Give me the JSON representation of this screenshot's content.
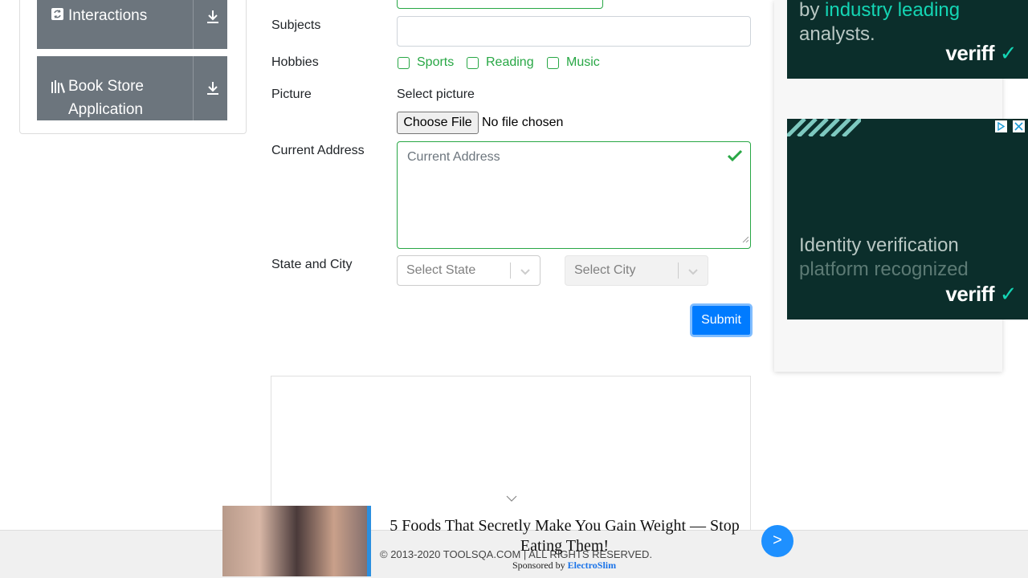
{
  "sidebar": {
    "groups": [
      {
        "label": "Interactions",
        "icon": "refresh-icon"
      },
      {
        "label_line1": "Book Store",
        "label_line2": "Application",
        "icon": "books-icon"
      }
    ]
  },
  "form": {
    "subjects_label": "Subjects",
    "hobbies_label": "Hobbies",
    "hobbies": [
      "Sports",
      "Reading",
      "Music"
    ],
    "picture_label": "Picture",
    "picture_prompt": "Select picture",
    "file_button": "Choose File",
    "file_status": "No file chosen",
    "address_label": "Current Address",
    "address_placeholder": "Current Address",
    "state_city_label": "State and City",
    "state_placeholder": "Select State",
    "city_placeholder": "Select City",
    "submit_label": "Submit"
  },
  "ads": {
    "top_line1_prefix": "by ",
    "top_line1_highlight": "industry leading",
    "top_line2": "analysts.",
    "brand": "veriff",
    "mid_line1": "Identity verification",
    "mid_line2": "platform recognized"
  },
  "footer": {
    "copyright": "© 2013-2020 TOOLSQA.COM | ALL RIGHTS RESERVED."
  },
  "sponsored": {
    "title": "5 Foods That Secretly Make You Gain Weight — Stop Eating Them!",
    "by_prefix": "Sponsored by ",
    "by_brand": "ElectroSlim",
    "next_label": ">"
  },
  "colors": {
    "accent_green": "#28a745",
    "primary_blue": "#007bff",
    "sidebar_grey": "#6c757d",
    "veriff_dark": "#0b2e2b",
    "veriff_teal": "#14d5b4"
  }
}
